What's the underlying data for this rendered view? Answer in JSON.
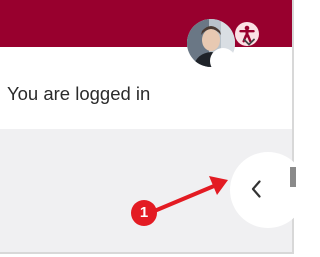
{
  "header": {
    "bg_color": "#98002e",
    "accessibility_icon": "accessibility-icon"
  },
  "user_menu": {
    "logged_in_text": "You are logged in",
    "avatar_icon": "user-avatar",
    "chevron_icon": "chevron-down-icon"
  },
  "drawer": {
    "toggle_icon": "chevron-left-icon"
  },
  "annotation": {
    "step_number": "1",
    "color": "#e31b23"
  }
}
